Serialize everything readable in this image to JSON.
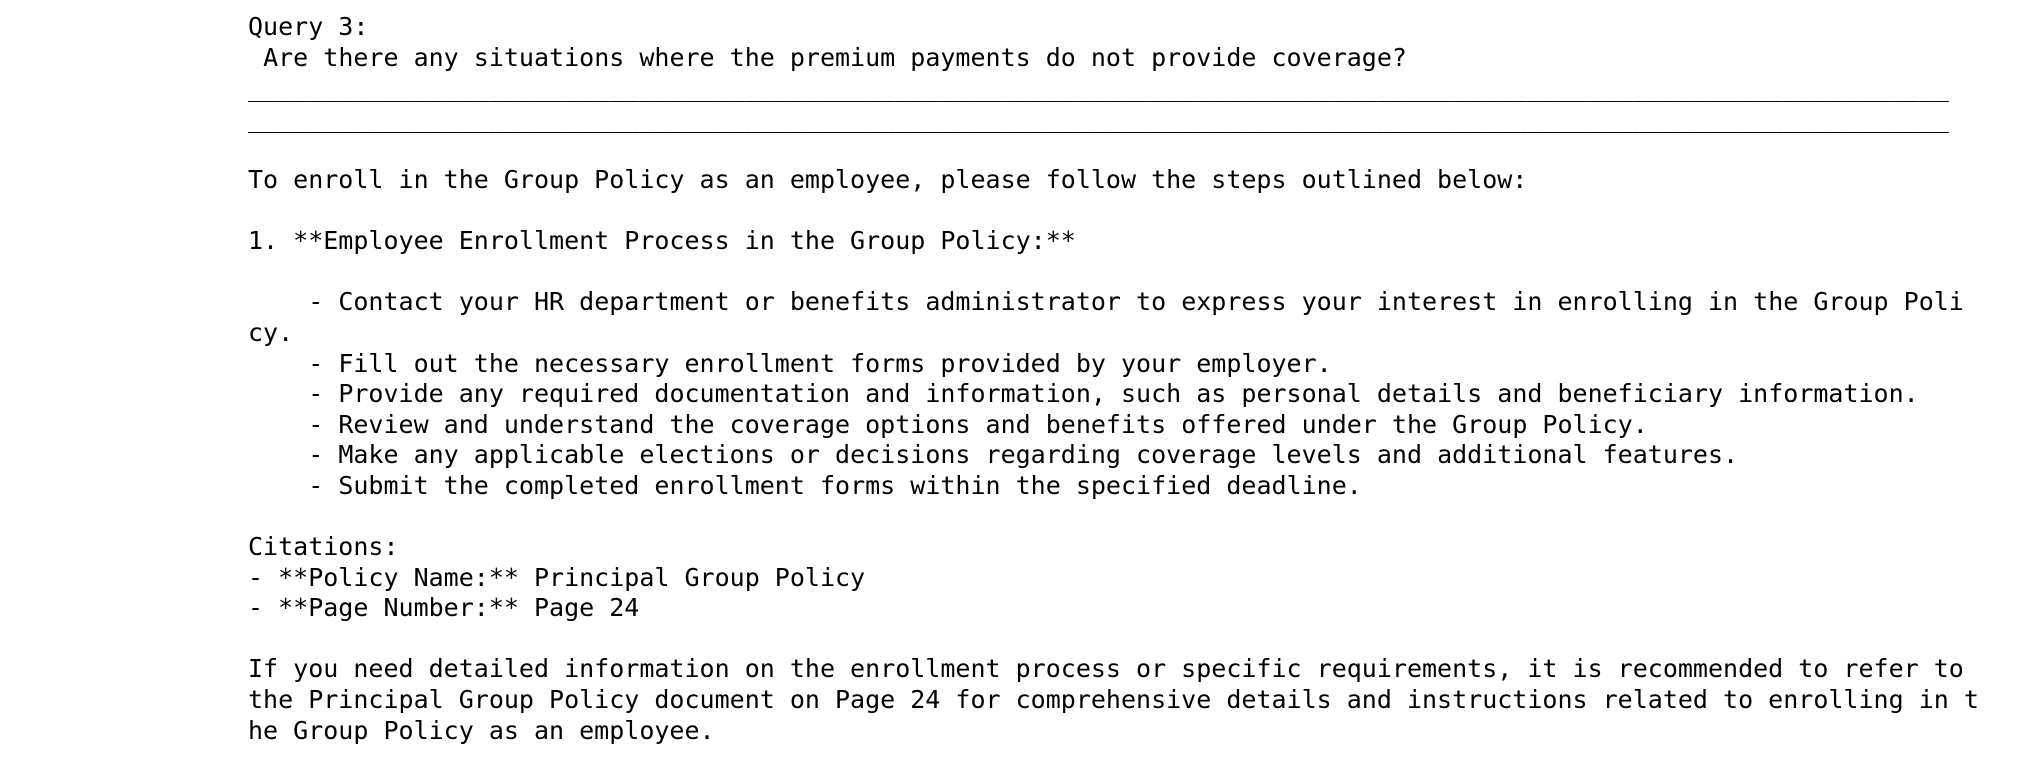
{
  "query_label": "Query 3:",
  "query_text": " Are there any situations where the premium payments do not provide coverage?",
  "rule1": "_________________________________________________________________________________________________________________",
  "rule2": "_________________________________________________________________________________________________________________",
  "intro": "To enroll in the Group Policy as an employee, please follow the steps outlined below:",
  "section_heading": "1. **Employee Enrollment Process in the Group Policy:**",
  "steps": [
    "    - Contact your HR department or benefits administrator to express your interest in enrolling in the Group Policy.",
    "    - Fill out the necessary enrollment forms provided by your employer.",
    "    - Provide any required documentation and information, such as personal details and beneficiary information.",
    "    - Review and understand the coverage options and benefits offered under the Group Policy.",
    "    - Make any applicable elections or decisions regarding coverage levels and additional features.",
    "    - Submit the completed enrollment forms within the specified deadline."
  ],
  "citations_label": "Citations:",
  "citations": [
    "- **Policy Name:** Principal Group Policy",
    "- **Page Number:** Page 24"
  ],
  "closing": "If you need detailed information on the enrollment process or specific requirements, it is recommended to refer to the Principal Group Policy document on Page 24 for comprehensive details and instructions related to enrolling in the Group Policy as an employee."
}
